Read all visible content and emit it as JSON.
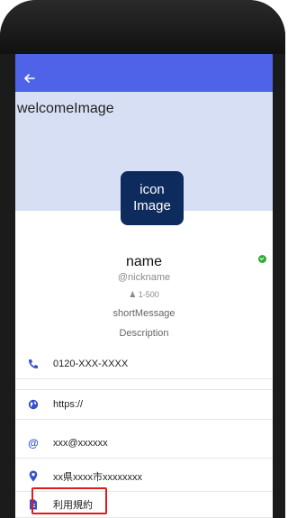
{
  "hero": {
    "text": "welcomeImage"
  },
  "icon_image": {
    "line1": "icon",
    "line2": "Image"
  },
  "profile": {
    "name": "name",
    "nickname": "@nickname",
    "followers": "1-500",
    "short_message": "shortMessage",
    "description": "Description"
  },
  "info": {
    "phone": "0120-XXX-XXXX",
    "website": "https://",
    "email": "xxx@xxxxxx",
    "address": "xx県xxxx市xxxxxxxx",
    "terms": "利用規約"
  },
  "colors": {
    "appbar": "#4f63e8",
    "hero": "#d6dff3",
    "icon_bg": "#0d2b5c",
    "accent": "#3550c8",
    "status": "#2eaa36",
    "highlight": "#e01b1b"
  },
  "icons": {
    "back": "arrow-left-icon",
    "phone": "phone-icon",
    "web": "globe-icon",
    "email": "at-icon",
    "address": "location-pin-icon",
    "terms": "document-icon",
    "followers": "person-icon",
    "status": "check-circle-icon"
  }
}
